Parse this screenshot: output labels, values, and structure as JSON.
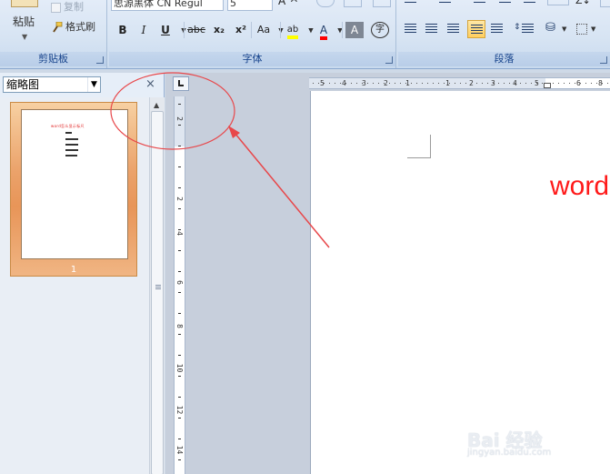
{
  "clipboard": {
    "paste_label": "粘贴",
    "copy_label": "复制",
    "format_painter_label": "格式刷",
    "group_label": "剪贴板"
  },
  "font": {
    "font_name": "思源黑体 CN Regul",
    "font_size": "5",
    "group_label": "字体",
    "bold": "B",
    "italic": "I",
    "underline": "U",
    "strikethrough": "abc",
    "subscript": "x₂",
    "superscript": "x²",
    "change_case": "Aa",
    "highlight": "ab",
    "font_color": "A",
    "char_shading": "A",
    "enclose": "字"
  },
  "paragraph": {
    "group_label": "段落"
  },
  "nav_pane": {
    "view_select": "缩略图",
    "close": "×",
    "thumbnails": [
      {
        "page_number": "1",
        "title_text": "word怎么显示标尺"
      }
    ]
  },
  "ruler": {
    "h_ticks": [
      "5",
      "4",
      "3",
      "2",
      "1",
      "1",
      "2",
      "3",
      "4",
      "5",
      "6",
      "8"
    ],
    "v_ticks": [
      "2",
      "2",
      "4",
      "6",
      "8",
      "10",
      "12",
      "14"
    ]
  },
  "document": {
    "visible_text": "word"
  },
  "watermark": {
    "main": "Bai 经验",
    "sub": "jingyan.baidu.com"
  },
  "colors": {
    "annotation_red": "#e8474a",
    "doc_text_red": "#ff1a1a",
    "thumb_orange": "#eba26a"
  }
}
